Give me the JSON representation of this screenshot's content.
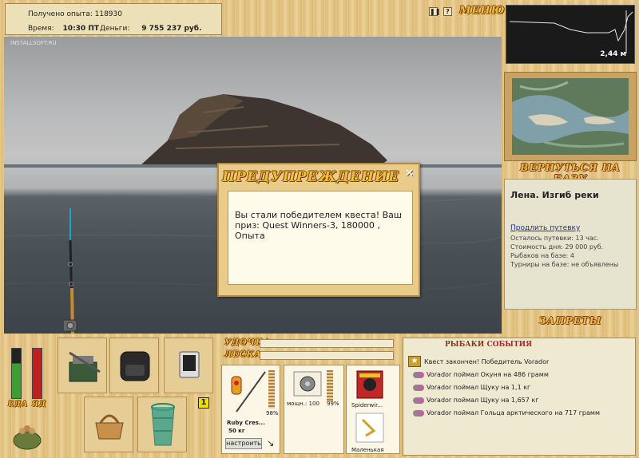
{
  "stats": {
    "xp_label": "Получено опыта:",
    "xp_value": "118930",
    "time_label": "Время:",
    "time_value": "10:30 ПТ",
    "money_label": "Деньги:",
    "money_value": "9 755 237 руб."
  },
  "topbar": {
    "pause_icon": "pause-icon",
    "help_label": "?",
    "menu_label": "МЕНЮ"
  },
  "scene": {
    "watermark": "INSTALLSOFT.RU"
  },
  "dialog": {
    "title": "ПРЕДУПРЕЖДЕНИЕ",
    "close_label": "✕",
    "message": "Вы стали победителем квеста! Ваш приз: Quest Winners-3, 180000 , Опыта"
  },
  "depth": {
    "value": "2,44 м"
  },
  "right": {
    "back_label": "ВЕРНУТЬСЯ НА БАЗУ",
    "location": "Лена. Изгиб реки",
    "extend_label": "Продлить путевку",
    "lines": [
      "Осталось путевки: 13 час.",
      "Стоимость дня: 29 000 руб.",
      "Рыбаков на базе: 4",
      "Турниры на базе: не объявлены"
    ],
    "bans_label": "ЗАПРЕТЫ"
  },
  "status": {
    "food_label": "ЕДА",
    "poison_label": "ЯД",
    "slot_counter": "1"
  },
  "tackle": {
    "rod_label": "УДОЧКА",
    "line_label": "ЛЕСКА",
    "lure_name": "Ruby Cres...",
    "lure_weight": "50 кг",
    "rod_pct": "98%",
    "reel_caption": "мощн.: 100",
    "reel_pct": "99%",
    "line_caption": "Spiderwir...",
    "hook_caption": "Маленькая",
    "adjust_label": "настроить"
  },
  "events": {
    "title_a": "РЫБАКИ",
    "title_b": "СОБЫТИЯ",
    "items": [
      "Квест закончен! Победитель Vorador",
      "Vorador поймал Окуня на 486 грамм",
      "Vorador поймал Щуку на 1,1 кг",
      "Vorador поймал Щуку на 1,657 кг",
      "Vorador поймал Гольца арктического на 717 грамм"
    ]
  },
  "colors": {
    "gold_title": "#f0c030",
    "title_outline": "#7a3b10",
    "wood": "#e2c282",
    "event_red": "#c02020"
  }
}
